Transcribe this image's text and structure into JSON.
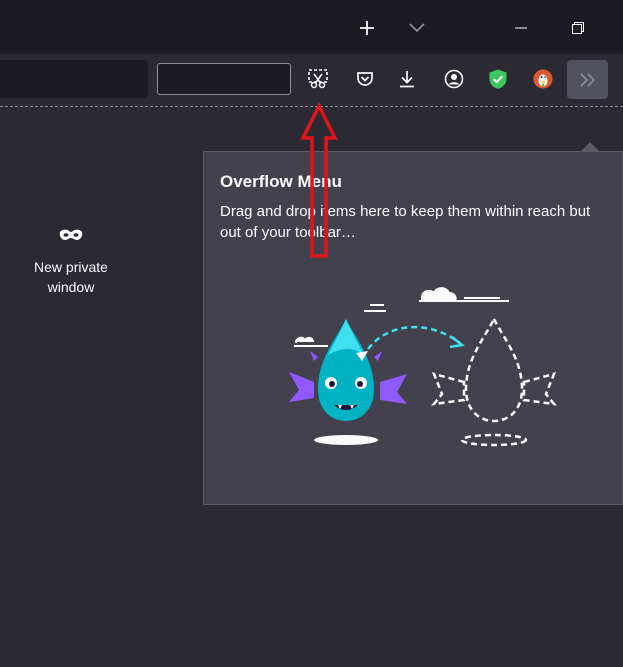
{
  "window": {
    "new_tab_icon": "plus-icon",
    "tab_list_icon": "chevron-down-icon",
    "minimize_icon": "minimize-icon",
    "restore_icon": "restore-icon"
  },
  "toolbar": {
    "search_value": "",
    "icons": [
      "screenshot-icon",
      "pocket-icon",
      "download-icon",
      "account-icon",
      "shield-check-icon",
      "duckduckgo-icon"
    ],
    "overflow_icon": "double-chevron-right-icon"
  },
  "new_private_window": {
    "icon": "mask-icon",
    "label_line1": "New private",
    "label_line2": "window"
  },
  "overflow_panel": {
    "title": "Overflow Menu",
    "description": "Drag and drop items here to keep them within reach but out of your toolbar…"
  },
  "annotation": {
    "color": "#e0151b",
    "pointer": "red-arrow-annotation"
  },
  "colors": {
    "titlebar": "#1c1b22",
    "toolbar": "#2b2a33",
    "panel": "#42414d",
    "accent_cyan": "#3fe1f0",
    "mascot_purple": "#9059ff",
    "mascot_teal": "#00b3c4",
    "shield_green": "#3fc55f",
    "duck_orange": "#de5833"
  }
}
